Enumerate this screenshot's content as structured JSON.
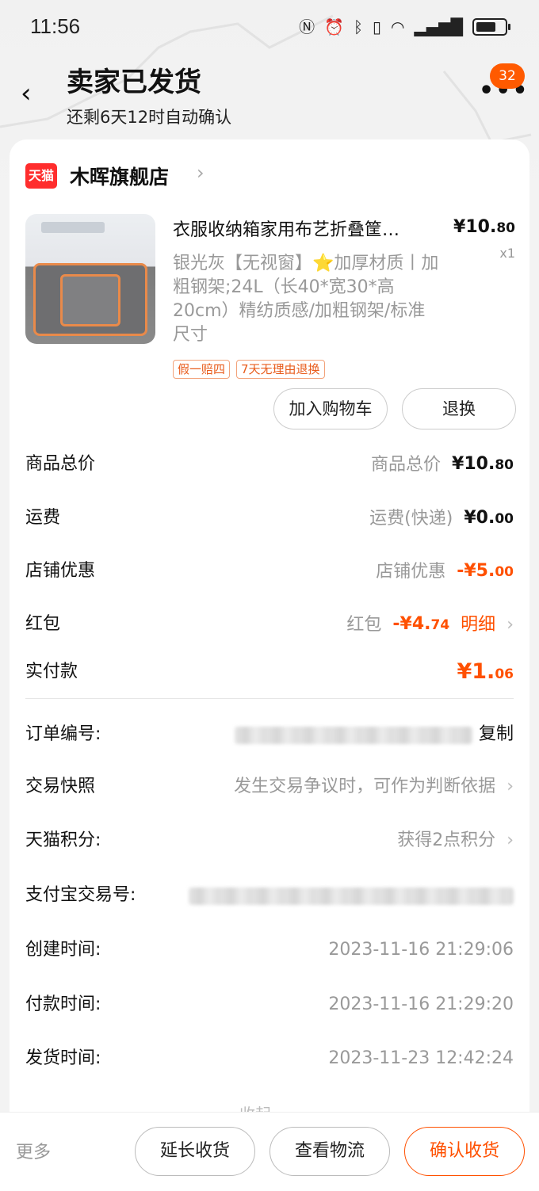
{
  "status_bar": {
    "time": "11:56",
    "icons": [
      "nfc-icon",
      "alarm-icon",
      "bluetooth-icon",
      "vibrate-icon",
      "wifi-icon",
      "signal-icon",
      "battery-icon"
    ]
  },
  "header": {
    "title": "卖家已发货",
    "subtitle": "还剩6天12时自动确认",
    "badge_count": "32"
  },
  "shop": {
    "logo_text": "天猫",
    "name": "木晖旗舰店"
  },
  "product": {
    "title": "衣服收纳箱家用布艺折叠筐…",
    "price_int": "¥10.",
    "price_dec": "80",
    "qty": "x1",
    "spec": "银光灰【无视窗】⭐加厚材质丨加粗钢架;24L（长40*宽30*高20cm）精纺质感/加粗钢架/标准尺寸",
    "tags": [
      "假一赔四",
      "7天无理由退换"
    ],
    "add_cart_label": "加入购物车",
    "return_label": "退换"
  },
  "fees": {
    "goods_total": {
      "label": "商品总价",
      "sub": "商品总价",
      "int": "¥10.",
      "dec": "80"
    },
    "shipping": {
      "label": "运费",
      "sub": "运费(快递)",
      "int": "¥0.",
      "dec": "00"
    },
    "shop_discount": {
      "label": "店铺优惠",
      "sub": "店铺优惠",
      "int": "-¥5.",
      "dec": "00"
    },
    "red_packet": {
      "label": "红包",
      "sub": "红包",
      "int": "-¥4.",
      "dec": "74",
      "detail": "明细"
    },
    "paid": {
      "label": "实付款",
      "int": "¥1.",
      "dec": "06"
    }
  },
  "info": {
    "order_no_label": "订单编号:",
    "copy_label": "复制",
    "snapshot_label": "交易快照",
    "snapshot_value": "发生交易争议时，可作为判断依据",
    "points_label": "天猫积分:",
    "points_value": "获得2点积分",
    "alipay_label": "支付宝交易号:",
    "created_label": "创建时间:",
    "created_value": "2023-11-16 21:29:06",
    "paid_label": "付款时间:",
    "paid_value": "2023-11-16 21:29:20",
    "shipped_label": "发货时间:",
    "shipped_value": "2023-11-23 12:42:24",
    "collapse_label": "收起"
  },
  "bottom": {
    "more": "更多",
    "extend": "延长收货",
    "logistics": "查看物流",
    "confirm": "确认收货"
  },
  "colors": {
    "accent": "#ff5000",
    "tmall_red": "#ff2d2d"
  }
}
